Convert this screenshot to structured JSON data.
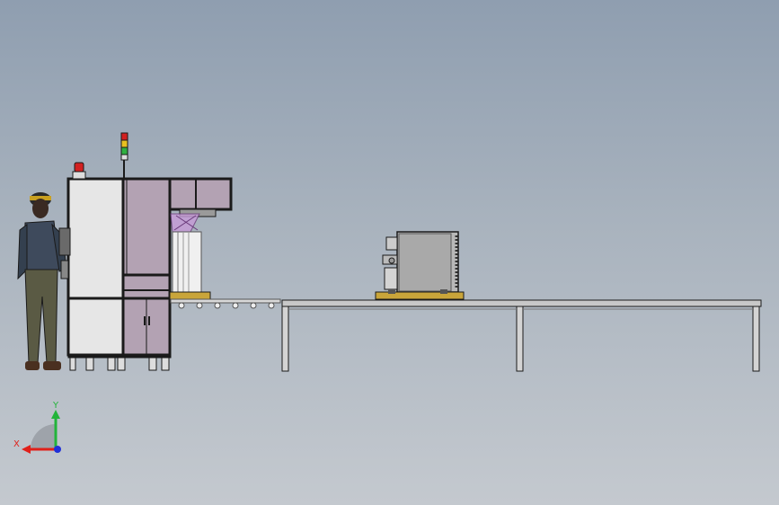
{
  "viewport": {
    "background_top": "#8f9eb0",
    "background_bottom": "#c4c9cf"
  },
  "triad": {
    "x_label": "X",
    "y_label": "Y",
    "x_color": "#e0201a",
    "y_color": "#22b43a",
    "z_color": "#2030d8"
  },
  "colors": {
    "frame": "#1a1a1a",
    "cabinet_white": "#e6e6e6",
    "panel_mauve": "#b3a2b3",
    "gold_pallet": "#c9a53a",
    "table_top": "#c8c8c8",
    "signal_red": "#d22020",
    "signal_yellow": "#e8c020",
    "signal_green": "#30b040"
  },
  "icons": [
    "operator-figure",
    "signal-tower",
    "warning-beacon",
    "axis-triad"
  ]
}
